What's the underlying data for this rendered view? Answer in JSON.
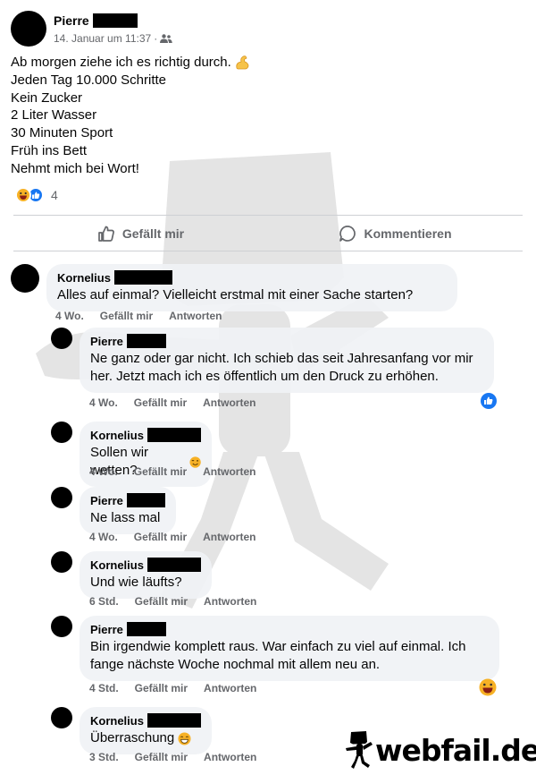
{
  "post": {
    "author": "Pierre",
    "timestamp": "14. Januar um 11:37",
    "separator": "·",
    "audience_icon": "friends-icon",
    "lines": [
      "Ab morgen ziehe ich es richtig durch.",
      "Jeden Tag 10.000 Schritte",
      "Kein Zucker",
      "2 Liter Wasser",
      "30 Minuten Sport",
      "Früh ins Bett",
      "Nehmt mich bei Wort!"
    ],
    "line1_emoji": "flexed-biceps-emoji",
    "reaction_count": "4",
    "reactions": [
      "haha",
      "like"
    ]
  },
  "actions": {
    "like_label": "Gefällt mir",
    "comment_label": "Kommentieren"
  },
  "comments": [
    {
      "author": "Kornelius",
      "text": "Alles auf einmal? Vielleicht erstmal mit einer Sache starten?",
      "age": "4 Wo.",
      "like": "Gefällt mir",
      "reply": "Antworten"
    },
    {
      "author": "Pierre",
      "text_lines": [
        "Ne ganz oder gar nicht. Ich schieb das seit Jahresanfang vor mir",
        "her. Jetzt mach ich es öffentlich um den Druck zu erhöhen."
      ],
      "age": "4 Wo.",
      "like": "Gefällt mir",
      "reply": "Antworten",
      "reaction": "like"
    },
    {
      "author": "Kornelius",
      "text": "Sollen wir wetten?",
      "emoji": "winking-face-emoji",
      "age": "4 Wo.",
      "like": "Gefällt mir",
      "reply": "Antworten"
    },
    {
      "author": "Pierre",
      "text": "Ne lass mal",
      "age": "4 Wo.",
      "like": "Gefällt mir",
      "reply": "Antworten"
    },
    {
      "author": "Kornelius",
      "text": "Und wie läufts?",
      "age": "6 Std.",
      "like": "Gefällt mir",
      "reply": "Antworten"
    },
    {
      "author": "Pierre",
      "text_lines": [
        "Bin irgendwie komplett raus. War einfach zu viel auf einmal. Ich",
        "fange nächste Woche nochmal mit allem neu an."
      ],
      "age": "4 Std.",
      "like": "Gefällt mir",
      "reply": "Antworten",
      "reaction": "haha"
    },
    {
      "author": "Kornelius",
      "text": "Überraschung",
      "emoji": "grinning-face-emoji",
      "age": "3 Std.",
      "like": "Gefällt mir",
      "reply": "Antworten"
    }
  ],
  "watermark": {
    "text": "webfail.de"
  },
  "colors": {
    "like_blue": "#1877f2",
    "haha_yellow": "#f7b125",
    "meta_gray": "#65676b",
    "bubble_gray": "#f0f2f5"
  }
}
